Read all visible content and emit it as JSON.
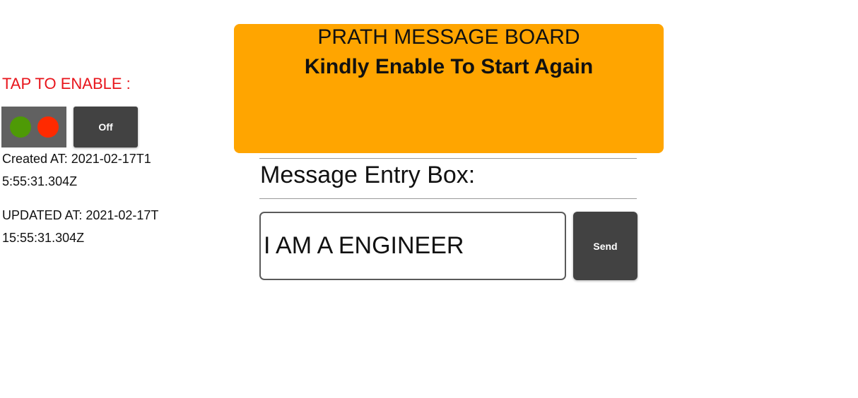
{
  "sidebar": {
    "tap_label": "TAP TO ENABLE :",
    "toggle_label": "Off",
    "indicator_colors": {
      "green": "#4e9a06",
      "red": "#ff2a00"
    },
    "created_at": "Created AT: 2021-02-17T15:55:31.304Z",
    "updated_at": "UPDATED AT: 2021-02-17T15:55:31.304Z"
  },
  "board": {
    "title": "PRATH MESSAGE BOARD",
    "subtitle": "Kindly Enable To Start Again",
    "background_color": "#ffa500"
  },
  "entry": {
    "heading": "Message Entry Box:",
    "message_value": "I AM A ENGINEER",
    "send_label": "Send"
  }
}
